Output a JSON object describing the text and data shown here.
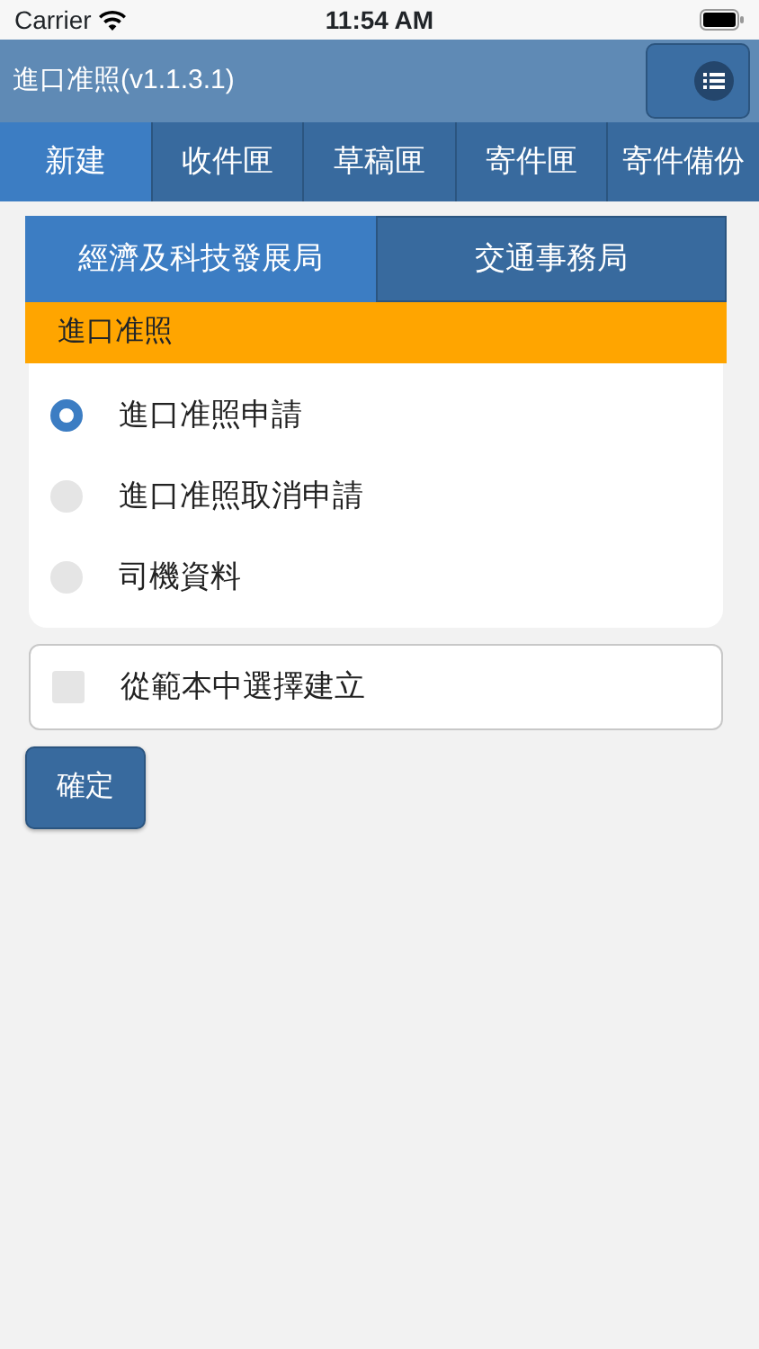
{
  "status_bar": {
    "carrier": "Carrier",
    "time": "11:54 AM"
  },
  "header": {
    "title": "進口准照(v1.1.3.1)"
  },
  "tabs": [
    {
      "label": "新建",
      "selected": true
    },
    {
      "label": "收件匣",
      "selected": false
    },
    {
      "label": "草稿匣",
      "selected": false
    },
    {
      "label": "寄件匣",
      "selected": false
    },
    {
      "label": "寄件備份",
      "selected": false
    }
  ],
  "departments": [
    {
      "label": "經濟及科技發展局",
      "selected": true
    },
    {
      "label": "交通事務局",
      "selected": false
    }
  ],
  "section_title": "進口准照",
  "options": [
    {
      "label": "進口准照申請",
      "selected": true
    },
    {
      "label": "進口准照取消申請",
      "selected": false
    },
    {
      "label": "司機資料",
      "selected": false
    }
  ],
  "template": {
    "label": "從範本中選擇建立",
    "checked": false
  },
  "confirm_button": "確定"
}
